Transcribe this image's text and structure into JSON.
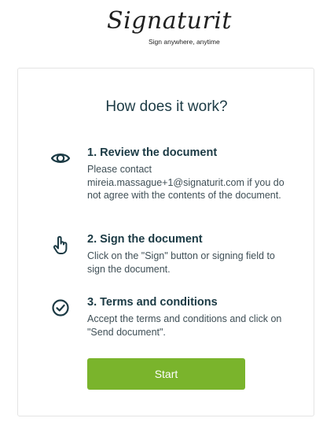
{
  "brand": {
    "name": "Signaturit",
    "tagline": "Sign anywhere, anytime"
  },
  "card": {
    "title": "How does it work?",
    "steps": [
      {
        "icon": "eye-icon",
        "heading": "1. Review the document",
        "text": "Please contact mireia.massague+1@signaturit.com if you do not agree with the contents of the document."
      },
      {
        "icon": "hand-pointer-icon",
        "heading": "2. Sign the document",
        "text": "Click on the \"Sign\" button or signing field to sign the document."
      },
      {
        "icon": "check-circle-icon",
        "heading": "3. Terms and conditions",
        "text": "Accept the terms and conditions and click on \"Send document\"."
      }
    ],
    "start_label": "Start"
  },
  "colors": {
    "accent": "#7ab42c",
    "heading": "#1b3a44",
    "body_text": "#3f4f56",
    "border": "#e4e4e4"
  }
}
